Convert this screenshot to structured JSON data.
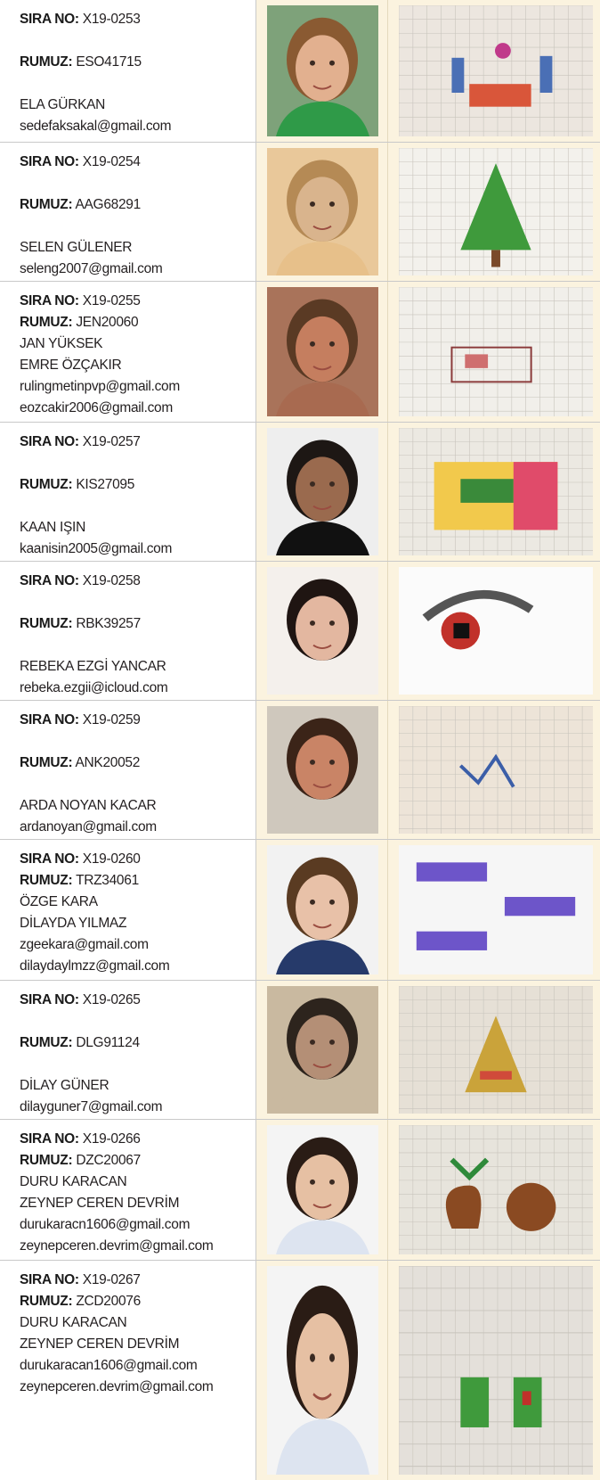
{
  "labels": {
    "sira": "SIRA NO:",
    "rumuz": "RUMUZ:"
  },
  "rows": [
    {
      "sira": "X19-0253",
      "rumuz": "ESO41715",
      "names": [
        "ELA GÜRKAN"
      ],
      "emails": [
        "sedefaksakal@gmail.com"
      ],
      "compact": false,
      "photo_icon": "student-photo",
      "art_icon": "drawing-houses"
    },
    {
      "sira": "X19-0254",
      "rumuz": "AAG68291",
      "names": [
        "SELEN GÜLENER"
      ],
      "emails": [
        "seleng2007@gmail.com"
      ],
      "compact": false,
      "photo_icon": "student-photo",
      "art_icon": "drawing-tree"
    },
    {
      "sira": "X19-0255",
      "rumuz": "JEN20060",
      "names": [
        "JAN YÜKSEK",
        "EMRE ÖZÇAKIR"
      ],
      "emails": [
        "rulingmetinpvp@gmail.com",
        "eozcakir2006@gmail.com"
      ],
      "compact": true,
      "photo_icon": "student-photo",
      "art_icon": "drawing-sketch"
    },
    {
      "sira": "X19-0257",
      "rumuz": "KIS27095",
      "names": [
        "KAAN IŞIN"
      ],
      "emails": [
        "kaanisin2005@gmail.com"
      ],
      "compact": false,
      "photo_icon": "student-photo",
      "art_icon": "drawing-room"
    },
    {
      "sira": "X19-0258",
      "rumuz": "RBK39257",
      "names": [
        "REBEKA EZGİ YANCAR"
      ],
      "emails": [
        "rebeka.ezgii@icloud.com"
      ],
      "compact": false,
      "photo_icon": "student-photo",
      "art_icon": "drawing-eye"
    },
    {
      "sira": "X19-0259",
      "rumuz": "ANK20052",
      "names": [
        "ARDA NOYAN KACAR"
      ],
      "emails": [
        "ardanoyan@gmail.com"
      ],
      "compact": false,
      "photo_icon": "student-photo",
      "art_icon": "drawing-figures"
    },
    {
      "sira": "X19-0260",
      "rumuz": "TRZ34061",
      "names": [
        "ÖZGE KARA",
        "DİLAYDA YILMAZ"
      ],
      "emails": [
        "zgeekara@gmail.com",
        "dilaydaylmzz@gmail.com"
      ],
      "compact": true,
      "photo_icon": "student-photo",
      "art_icon": "render-tables"
    },
    {
      "sira": "X19-0265",
      "rumuz": "DLG91124",
      "names": [
        "DİLAY GÜNER"
      ],
      "emails": [
        "dilayguner7@gmail.com"
      ],
      "compact": false,
      "photo_icon": "student-photo",
      "art_icon": "drawing-pyramid"
    },
    {
      "sira": "X19-0266",
      "rumuz": "DZC20067",
      "names": [
        "DURU KARACAN",
        "ZEYNEP CEREN DEVRİM"
      ],
      "emails": [
        "durukaracn1606@gmail.com",
        "zeynepceren.devrim@gmail.com"
      ],
      "compact": true,
      "photo_icon": "student-photo",
      "art_icon": "drawing-palms"
    },
    {
      "sira": "X19-0267",
      "rumuz": "ZCD20076",
      "names": [
        "DURU KARACAN",
        "ZEYNEP CEREN DEVRİM"
      ],
      "emails": [
        "durukaracan1606@gmail.com",
        "zeynepceren.devrim@gmail.com"
      ],
      "compact": true,
      "photo_icon": "student-photo",
      "art_icon": "drawing-blocks"
    }
  ],
  "colors": {
    "border": "#c9c9c9",
    "cream": "#fbf3df",
    "text": "#231f20"
  }
}
